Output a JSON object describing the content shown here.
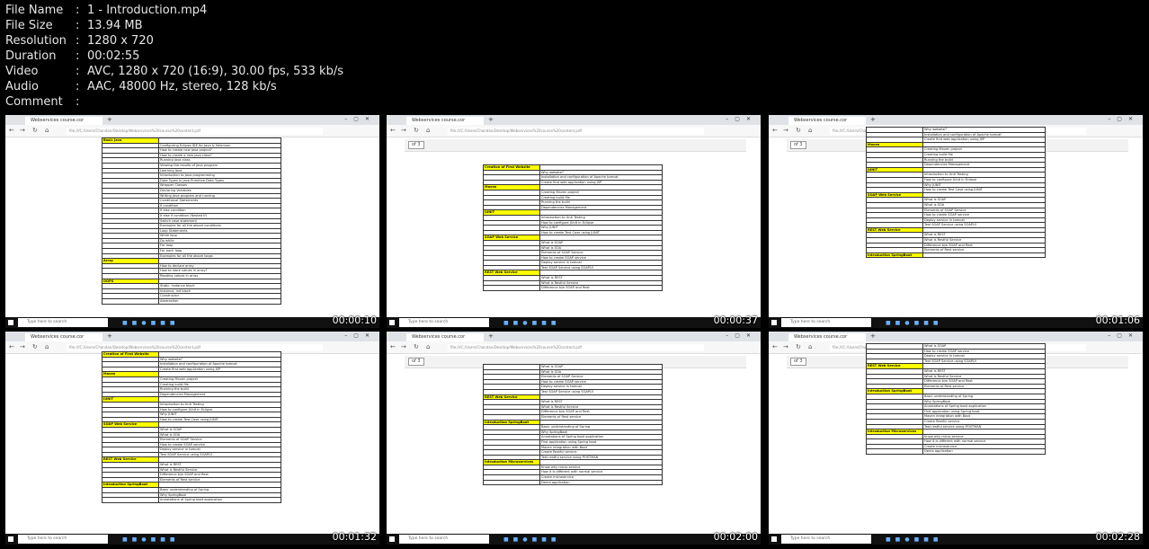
{
  "meta": [
    {
      "key": "File Name",
      "value": "1 - Introduction.mp4"
    },
    {
      "key": "File Size",
      "value": "13.94 MB"
    },
    {
      "key": "Resolution",
      "value": "1280 x 720"
    },
    {
      "key": "Duration",
      "value": "00:02:55"
    },
    {
      "key": "Video",
      "value": "AVC, 1280 x 720 (16:9), 30.00 fps, 533 kb/s"
    },
    {
      "key": "Audio",
      "value": "AAC, 48000 Hz, stereo, 128 kb/s"
    },
    {
      "key": "Comment",
      "value": ""
    }
  ],
  "meta_sep": ":",
  "browser": {
    "tab_title": "Webservices course.cor",
    "url": "file:///C:/Users/Chandan/Desktop/Webservices%20course%20content.pdf",
    "page_label": "of 3"
  },
  "taskbar": {
    "search_placeholder": "Type here to search"
  },
  "thumbnails": [
    {
      "timestamp": "00:00:10",
      "rows": [
        [
          "Basic Java",
          ""
        ],
        [
          "",
          "Configuring Eclipse IDE for Java & Selenium"
        ],
        [
          "",
          "How to create new java project?"
        ],
        [
          "",
          "How to create a new java class?"
        ],
        [
          "",
          "Running java class"
        ],
        [
          "",
          "Viewing the results of java program"
        ],
        [
          "",
          "Learning Java"
        ],
        [
          "",
          "Introduction to Java programming"
        ],
        [
          "",
          "Data Types in Java Primitive Data Types"
        ],
        [
          "",
          "Wrapper Classes"
        ],
        [
          "",
          "Declaring Variables"
        ],
        [
          "",
          "Writing Java program and running"
        ],
        [
          "",
          "Conditional Statements"
        ],
        [
          "",
          "If condition"
        ],
        [
          "",
          "If else condition"
        ],
        [
          "",
          "If else if condition (Nested If)"
        ],
        [
          "",
          "Switch case statement"
        ],
        [
          "",
          "Examples for all the above conditions"
        ],
        [
          "",
          "Loop Statements"
        ],
        [
          "",
          "While loop"
        ],
        [
          "",
          "Do while"
        ],
        [
          "",
          "For loop"
        ],
        [
          "",
          "For each loop"
        ],
        [
          "",
          "Examples for all the above loops"
        ],
        [
          "Array",
          ""
        ],
        [
          "",
          "How to declare array"
        ],
        [
          "",
          "How to store values in array?"
        ],
        [
          "",
          "Reading values in array"
        ],
        [
          "OOPS",
          ""
        ],
        [
          "",
          "Static, Instance block"
        ],
        [
          "",
          "Instance, init block"
        ],
        [
          "",
          "Constructor"
        ],
        [
          "",
          "Abstraction"
        ]
      ]
    },
    {
      "timestamp": "00:00:37",
      "rows": [
        [
          "Creation of First Website",
          ""
        ],
        [
          "",
          "Why website?"
        ],
        [
          "",
          "Installation and configuration of Apache tomcat"
        ],
        [
          "",
          "Create first web application using JSP"
        ],
        [
          "Maven",
          ""
        ],
        [
          "",
          "Creating Maven project"
        ],
        [
          "",
          "Creating build file"
        ],
        [
          "",
          "Running the build"
        ],
        [
          "",
          "Dependencies Management"
        ],
        [
          "JUNIT",
          ""
        ],
        [
          "",
          "Introduction to Unit Testing"
        ],
        [
          "",
          "How to configure JUnit in Eclipse"
        ],
        [
          "",
          "Why JUNIT"
        ],
        [
          "",
          "How to create Test Case using JUNIT"
        ],
        [
          "SOAP Web Service",
          ""
        ],
        [
          "",
          "What is SOAP"
        ],
        [
          "",
          "What is SOA"
        ],
        [
          "",
          "Elements of SOAP Service"
        ],
        [
          "",
          "How to create SOAP service"
        ],
        [
          "",
          "Deploy service in tomcat"
        ],
        [
          "",
          "Test SOAP Service using SOAPUI"
        ],
        [
          "REST Web Service",
          ""
        ],
        [
          "",
          "What is REST"
        ],
        [
          "",
          "What is Restful Service"
        ],
        [
          "",
          "Difference b/w SOAP and Rest"
        ]
      ]
    },
    {
      "timestamp": "00:01:06",
      "rows": [
        [
          "",
          "Why website?"
        ],
        [
          "",
          "Installation and configuration of Apache tomcat"
        ],
        [
          "",
          "Create first web application using JSP"
        ],
        [
          "Maven",
          ""
        ],
        [
          "",
          "Creating Maven project"
        ],
        [
          "",
          "Creating build file"
        ],
        [
          "",
          "Running the build"
        ],
        [
          "",
          "Dependencies Management"
        ],
        [
          "JUNIT",
          ""
        ],
        [
          "",
          "Introduction to Unit Testing"
        ],
        [
          "",
          "How to configure JUnit in Eclipse"
        ],
        [
          "",
          "Why JUNIT"
        ],
        [
          "",
          "How to create Test Case using JUNIT"
        ],
        [
          "SOAP Web Service",
          ""
        ],
        [
          "",
          "What is SOAP"
        ],
        [
          "",
          "What is SOA"
        ],
        [
          "",
          "Elements of SOAP Service"
        ],
        [
          "",
          "How to create SOAP service"
        ],
        [
          "",
          "Deploy service in tomcat"
        ],
        [
          "",
          "Test SOAP Service using SOAPUI"
        ],
        [
          "REST Web Service",
          ""
        ],
        [
          "",
          "What is REST"
        ],
        [
          "",
          "What is Restful Service"
        ],
        [
          "",
          "Difference b/w SOAP and Rest"
        ],
        [
          "",
          "Elements of Rest service"
        ],
        [
          "Introduction SpringBoot",
          ""
        ]
      ]
    },
    {
      "timestamp": "00:01:32",
      "rows": [
        [
          "Creation of First Website",
          ""
        ],
        [
          "",
          "Why website?"
        ],
        [
          "",
          "Installation and configuration of Apache tomcat"
        ],
        [
          "",
          "Create first web application using JSP"
        ],
        [
          "Maven",
          ""
        ],
        [
          "",
          "Creating Maven project"
        ],
        [
          "",
          "Creating build file"
        ],
        [
          "",
          "Running the build"
        ],
        [
          "",
          "Dependencies Management"
        ],
        [
          "JUNIT",
          ""
        ],
        [
          "",
          "Introduction to Unit Testing"
        ],
        [
          "",
          "How to configure JUnit in Eclipse"
        ],
        [
          "",
          "Why JUNIT"
        ],
        [
          "",
          "How to create Test Case using JUNIT"
        ],
        [
          "SOAP Web Service",
          ""
        ],
        [
          "",
          "What is SOAP"
        ],
        [
          "",
          "What is SOA"
        ],
        [
          "",
          "Elements of SOAP Service"
        ],
        [
          "",
          "How to create SOAP service"
        ],
        [
          "",
          "Deploy service in tomcat"
        ],
        [
          "",
          "Test SOAP Service using SOAPUI"
        ],
        [
          "REST Web Service",
          ""
        ],
        [
          "",
          "What is REST"
        ],
        [
          "",
          "What is Restful Service"
        ],
        [
          "",
          "Difference b/w SOAP and Rest"
        ],
        [
          "",
          "Elements of Rest service"
        ],
        [
          "Introduction SpringBoot",
          ""
        ],
        [
          "",
          "Basic understanding of Spring"
        ],
        [
          "",
          "Why SpringBoot"
        ],
        [
          "",
          "Annotations of Spring boot application"
        ]
      ]
    },
    {
      "timestamp": "00:02:00",
      "rows": [
        [
          "",
          "What is SOAP"
        ],
        [
          "",
          "What is SOA"
        ],
        [
          "",
          "Elements of SOAP Service"
        ],
        [
          "",
          "How to create SOAP service"
        ],
        [
          "",
          "Deploy service in tomcat"
        ],
        [
          "",
          "Test SOAP Service using SOAPUI"
        ],
        [
          "REST Web Service",
          ""
        ],
        [
          "",
          "What is REST"
        ],
        [
          "",
          "What is Restful Service"
        ],
        [
          "",
          "Difference b/w SOAP and Rest"
        ],
        [
          "",
          "Elements of Rest service"
        ],
        [
          "Introduction SpringBoot",
          ""
        ],
        [
          "",
          "Basic understanding of Spring"
        ],
        [
          "",
          "Why SpringBoot"
        ],
        [
          "",
          "Annotations of Spring boot application"
        ],
        [
          "",
          "First application using Spring boot"
        ],
        [
          "",
          "Maven integration with Boot"
        ],
        [
          "",
          "Create Restful service"
        ],
        [
          "",
          "Test restful service using POSTMAN"
        ],
        [
          "Introduction Microservices",
          ""
        ],
        [
          "",
          "Know why micro service"
        ],
        [
          "",
          "How it is different with normal service"
        ],
        [
          "",
          "Create microservice"
        ],
        [
          "",
          "Demo application"
        ]
      ]
    },
    {
      "timestamp": "00:02:28",
      "rows": [
        [
          "",
          "What is SOAP"
        ],
        [
          "",
          "How to create SOAP service"
        ],
        [
          "",
          "Deploy service in tomcat"
        ],
        [
          "",
          "Test SOAP Service using SOAPUI"
        ],
        [
          "REST Web Service",
          ""
        ],
        [
          "",
          "What is REST"
        ],
        [
          "",
          "What is Restful Service"
        ],
        [
          "",
          "Difference b/w SOAP and Rest"
        ],
        [
          "",
          "Elements of Rest service"
        ],
        [
          "Introduction SpringBoot",
          ""
        ],
        [
          "",
          "Basic understanding of Spring"
        ],
        [
          "",
          "Why SpringBoot"
        ],
        [
          "",
          "Annotations of Spring boot application"
        ],
        [
          "",
          "First application using Spring boot"
        ],
        [
          "",
          "Maven integration with Boot"
        ],
        [
          "",
          "Create Restful service"
        ],
        [
          "",
          "Test restful service using POSTMAN"
        ],
        [
          "Introduction Microservices",
          ""
        ],
        [
          "",
          "Know why micro service"
        ],
        [
          "",
          "How it is different with normal service"
        ],
        [
          "",
          "Create microservice"
        ],
        [
          "",
          "Demo application"
        ]
      ]
    }
  ]
}
